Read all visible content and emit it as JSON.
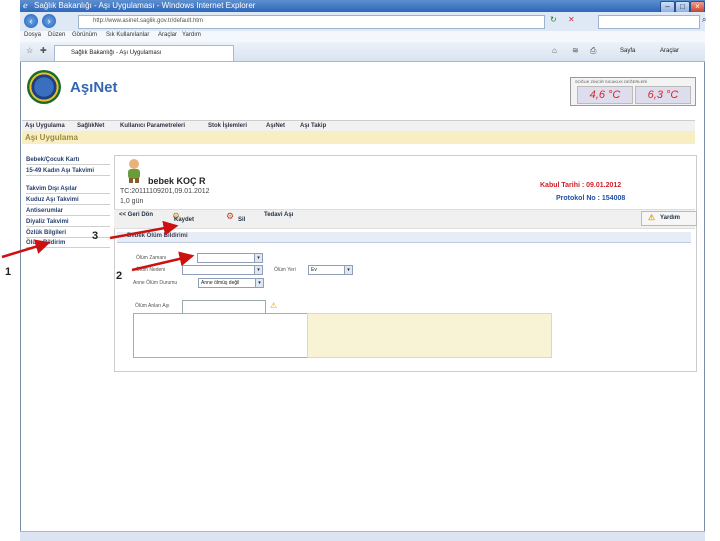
{
  "browser": {
    "title": "Sağlık Bakanlığı - Aşı Uygulaması - Windows Internet Explorer",
    "url": "http://www.asinet.saglik.gov.tr/default.htm",
    "menu": [
      "Dosya",
      "Düzen",
      "Görünüm",
      "Sık Kullanılanlar",
      "Araçlar",
      "Yardım"
    ],
    "tab_label": "Sağlık Bakanlığı - Aşı Uygulaması",
    "toolbar": [
      "Sayfa",
      "Araçlar"
    ]
  },
  "header": {
    "brand": "AşıNet",
    "temperature_label": "SOĞUK ZİNCİR SICAKLIK DEĞERLERİ",
    "temp1": "4,6 °C",
    "temp2": "6,3 °C"
  },
  "mainnav": [
    "Aşı Uygulama",
    "SağlıkNet",
    "Kullanıcı Parametreleri",
    "Stok İşlemleri",
    "AşıNet",
    "Aşı Takip"
  ],
  "page_title": "Aşı Uygulama",
  "sidebar": [
    "Bebek/Çocuk Kartı",
    "15-49 Kadın Aşı Takvimi",
    "Takvim Dışı Aşılar",
    "Kuduz Aşı Takvimi",
    "Antiserumlar",
    "Diyaliz Takvimi",
    "Özlük Bilgileri",
    "Ölüm Bildirim"
  ],
  "patient": {
    "name": "bebek KOÇ R",
    "tc_line": "TC:20111109201,09.01.2012",
    "age": "1,0 gün",
    "kabul": "Kabul Tarihi : 09.01.2012",
    "protokol": "Protokol No : 154008"
  },
  "actions": {
    "back": "<< Geri Dön",
    "save": "Kaydet",
    "delete": "Sil",
    "treatment": "Tedavi Aşı",
    "help": "Yardım"
  },
  "form": {
    "header": "Bebek Ölüm Bildirimi",
    "field1_label": "Ölüm Zamanı",
    "field2_label": "Ölüm Nedeni",
    "place_label": "Ölüm Yeri",
    "place_value": "Ev",
    "mother_label": "Anne Ölüm Durumu",
    "mother_value": "Anne ölmüş değil",
    "age_label": "Ölüm Anları Aşı"
  },
  "annotations": [
    "1",
    "2",
    "3"
  ]
}
